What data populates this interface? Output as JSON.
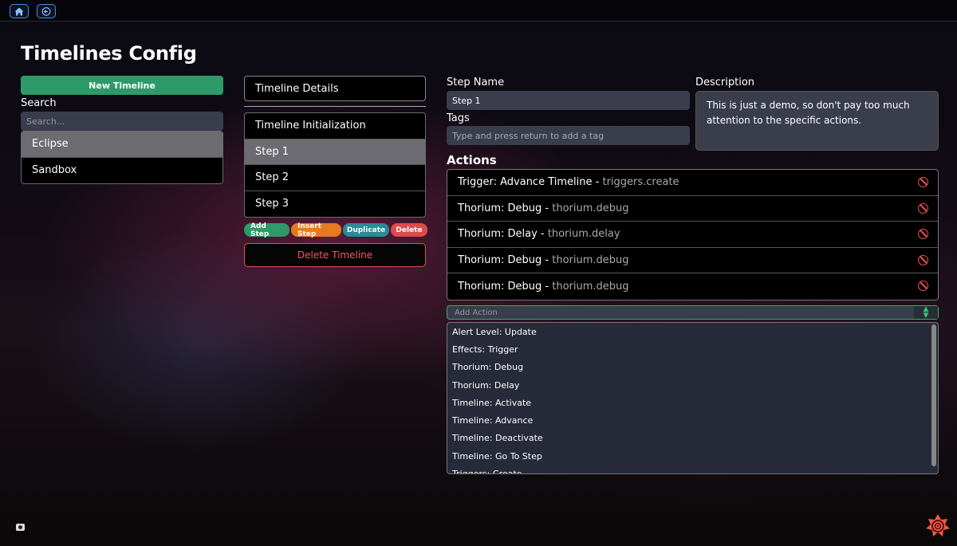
{
  "page": {
    "title": "Timelines Config"
  },
  "colors": {
    "accent_green": "#2e9a6a",
    "accent_orange": "#e57a1e",
    "accent_teal": "#2a8a98",
    "danger": "#e04a4a"
  },
  "sidebar": {
    "new_timeline_label": "New Timeline",
    "search_label": "Search",
    "search_placeholder": "Search...",
    "timelines": [
      {
        "label": "Eclipse",
        "active": true
      },
      {
        "label": "Sandbox",
        "active": false
      }
    ]
  },
  "steps_panel": {
    "details_label": "Timeline Details",
    "steps": [
      {
        "label": "Timeline Initialization",
        "active": false
      },
      {
        "label": "Step 1",
        "active": true
      },
      {
        "label": "Step 2",
        "active": false
      },
      {
        "label": "Step 3",
        "active": false
      }
    ],
    "buttons": {
      "add_step": "Add Step",
      "insert_step": "Insert Step",
      "duplicate": "Duplicate",
      "delete": "Delete"
    },
    "delete_timeline_label": "Delete Timeline"
  },
  "step_editor": {
    "step_name_label": "Step Name",
    "step_name_value": "Step 1",
    "tags_label": "Tags",
    "tags_placeholder": "Type and press return to add a tag",
    "description_label": "Description",
    "description_value": "This is just a demo, so don't pay too much attention to the specific actions.",
    "actions_label": "Actions",
    "actions": [
      {
        "name": "Trigger: Advance Timeline",
        "id": "triggers.create"
      },
      {
        "name": "Thorium: Debug",
        "id": "thorium.debug"
      },
      {
        "name": "Thorium: Delay",
        "id": "thorium.delay"
      },
      {
        "name": "Thorium: Debug",
        "id": "thorium.debug"
      },
      {
        "name": "Thorium: Debug",
        "id": "thorium.debug"
      }
    ],
    "add_action_placeholder": "Add Action",
    "action_options": [
      "Alert Level: Update",
      "Effects: Trigger",
      "Thorium: Debug",
      "Thorium: Delay",
      "Timeline: Activate",
      "Timeline: Advance",
      "Timeline: Deactivate",
      "Timeline: Go To Step",
      "Triggers: Create"
    ]
  },
  "icons": {
    "home": "home-icon",
    "back": "arrow-left-icon",
    "remove": "prohibited-icon",
    "camera": "camera-icon",
    "logo": "thorium-logo-icon"
  }
}
